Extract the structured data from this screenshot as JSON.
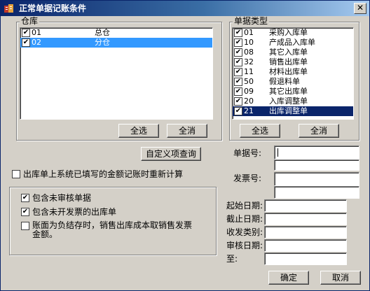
{
  "window": {
    "title": "正常单据记账条件",
    "close_glyph": "✕"
  },
  "warehouse_group": {
    "title": "仓库",
    "items": [
      {
        "code": "01",
        "name": "总仓",
        "checked": true,
        "selected": false
      },
      {
        "code": "02",
        "name": "分仓",
        "checked": true,
        "selected": true
      }
    ],
    "select_all_label": "全选",
    "clear_all_label": "全消"
  },
  "doc_type_group": {
    "title": "单据类型",
    "items": [
      {
        "code": "01",
        "name": "采购入库单",
        "checked": true,
        "selected": false
      },
      {
        "code": "10",
        "name": "产成品入库单",
        "checked": true,
        "selected": false
      },
      {
        "code": "08",
        "name": "其它入库单",
        "checked": true,
        "selected": false
      },
      {
        "code": "32",
        "name": "销售出库单",
        "checked": true,
        "selected": false
      },
      {
        "code": "11",
        "name": "材料出库单",
        "checked": true,
        "selected": false
      },
      {
        "code": "50",
        "name": "假退料单",
        "checked": true,
        "selected": false
      },
      {
        "code": "09",
        "name": "其它出库单",
        "checked": true,
        "selected": false
      },
      {
        "code": "20",
        "name": "入库调整单",
        "checked": true,
        "selected": false
      },
      {
        "code": "21",
        "name": "出库调整单",
        "checked": true,
        "selected": true
      }
    ],
    "select_all_label": "全选",
    "clear_all_label": "全消"
  },
  "custom_query_label": "自定义项查询",
  "recalc_option": {
    "label": "出库单上系统已填写的金额记账时重新计算",
    "checked": false
  },
  "options": [
    {
      "label": "包含未审核单据",
      "checked": true
    },
    {
      "label": "包含未开发票的出库单",
      "checked": true
    },
    {
      "label": "账面为负结存时，销售出库成本取销售发票金额。",
      "checked": false
    }
  ],
  "fields": {
    "doc_no_label": "单据号:",
    "invoice_no_label": "发票号:",
    "start_date_label": "起始日期:",
    "end_date_label": "截止日期:",
    "recv_send_label": "收发类别:",
    "audit_date_label": "审核日期:",
    "to_label": "至:"
  },
  "ok_label": "确定",
  "cancel_label": "取消",
  "icons": {
    "app": "ledger-icon",
    "check": "✔"
  }
}
